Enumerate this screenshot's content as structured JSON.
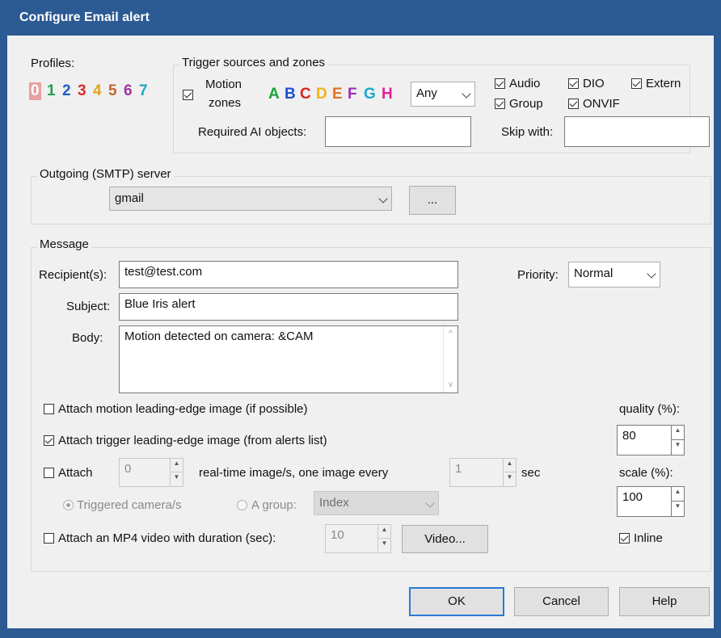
{
  "window": {
    "title": "Configure Email alert"
  },
  "profiles": {
    "label": "Profiles:",
    "items": [
      {
        "label": "0",
        "color": "#e8a0a0",
        "selected": true
      },
      {
        "label": "1",
        "color": "#22a04a"
      },
      {
        "label": "2",
        "color": "#1f5fc7"
      },
      {
        "label": "3",
        "color": "#d42b2b"
      },
      {
        "label": "4",
        "color": "#e0a417"
      },
      {
        "label": "5",
        "color": "#c8642d"
      },
      {
        "label": "6",
        "color": "#a033a0"
      },
      {
        "label": "7",
        "color": "#23a8b8"
      }
    ]
  },
  "trigger": {
    "legend": "Trigger sources and zones",
    "motion_label_line1": "Motion",
    "motion_label_line2": "zones",
    "motion_checked": true,
    "zones": [
      {
        "label": "A",
        "color": "#1aa43a"
      },
      {
        "label": "B",
        "color": "#1f4fd0"
      },
      {
        "label": "C",
        "color": "#d9231f"
      },
      {
        "label": "D",
        "color": "#f0b41c"
      },
      {
        "label": "E",
        "color": "#e2721f"
      },
      {
        "label": "F",
        "color": "#a12fb0"
      },
      {
        "label": "G",
        "color": "#19aacb"
      },
      {
        "label": "H",
        "color": "#e0219a"
      }
    ],
    "zone_mode": "Any",
    "audio": "Audio",
    "dio": "DIO",
    "extern": "Extern",
    "group": "Group",
    "onvif": "ONVIF",
    "required_ai_label": "Required AI objects:",
    "required_ai_value": "",
    "skip_with_label": "Skip with:",
    "skip_with_value": ""
  },
  "smtp": {
    "legend": "Outgoing (SMTP) server",
    "server": "gmail",
    "browse_label": "..."
  },
  "message": {
    "legend": "Message",
    "recipients_label": "Recipient(s):",
    "recipients_value": "test@test.com",
    "priority_label": "Priority:",
    "priority_value": "Normal",
    "subject_label": "Subject:",
    "subject_value": "Blue Iris alert",
    "body_label": "Body:",
    "body_value": "Motion detected on camera: &CAM",
    "attach_leading_motion": "Attach motion leading-edge image (if possible)",
    "attach_leading_motion_checked": false,
    "attach_trigger_leading": "Attach trigger leading-edge image (from alerts list)",
    "attach_trigger_leading_checked": true,
    "attach_label": "Attach",
    "attach_checked": false,
    "attach_count": "0",
    "realtime_label": "real-time image/s, one image every",
    "interval_value": "1",
    "interval_unit": "sec",
    "triggered_camera_label": "Triggered camera/s",
    "a_group_label": "A group:",
    "group_value": "Index",
    "attach_mp4_label": "Attach an MP4 video with duration (sec):",
    "attach_mp4_checked": false,
    "mp4_duration": "10",
    "video_button": "Video...",
    "quality_label": "quality (%):",
    "quality_value": "80",
    "scale_label": "scale (%):",
    "scale_value": "100",
    "inline_label": "Inline",
    "inline_checked": true
  },
  "buttons": {
    "ok": "OK",
    "cancel": "Cancel",
    "help": "Help"
  }
}
